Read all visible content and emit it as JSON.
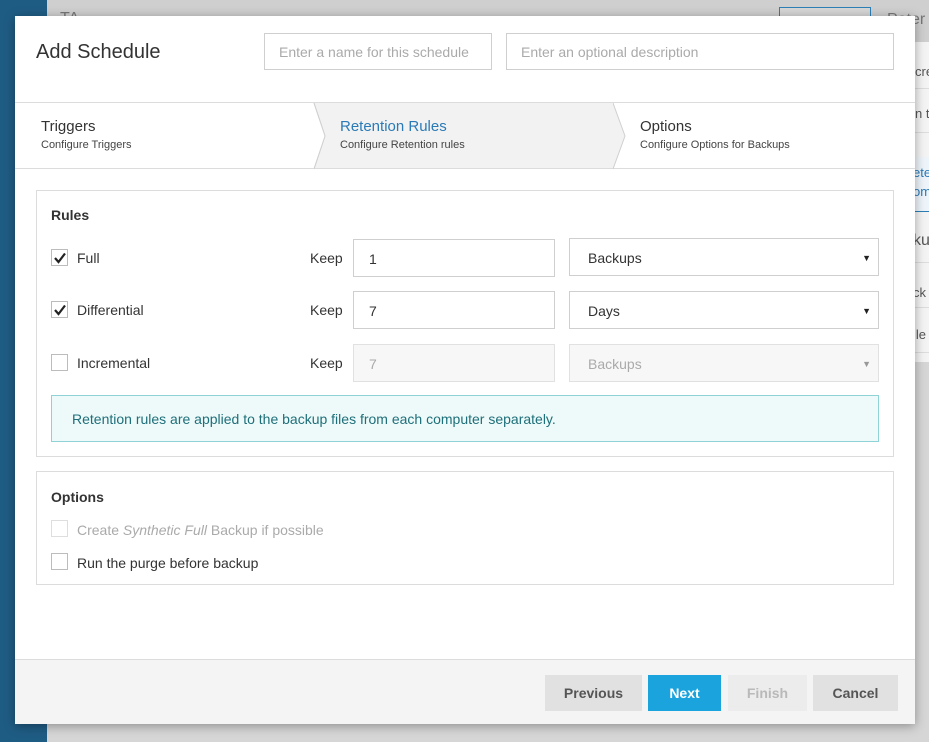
{
  "background": {
    "top_fragment": "TA",
    "right_fragments": [
      "Peter",
      "cre",
      "n t",
      "ete",
      "om",
      "ku",
      "ck",
      "ile"
    ]
  },
  "modal": {
    "title": "Add Schedule",
    "name_input": {
      "value": "",
      "placeholder": "Enter a name for this schedule"
    },
    "description_input": {
      "value": "",
      "placeholder": "Enter an optional description"
    }
  },
  "steps": [
    {
      "title": "Triggers",
      "subtitle": "Configure Triggers",
      "active": false
    },
    {
      "title": "Retention Rules",
      "subtitle": "Configure Retention rules",
      "active": true
    },
    {
      "title": "Options",
      "subtitle": "Configure Options for Backups",
      "active": false
    }
  ],
  "rules": {
    "title": "Rules",
    "keep_label": "Keep",
    "items": [
      {
        "label": "Full",
        "checked": true,
        "enabled": true,
        "keep_value": "1",
        "unit": "Backups"
      },
      {
        "label": "Differential",
        "checked": true,
        "enabled": true,
        "keep_value": "7",
        "unit": "Days"
      },
      {
        "label": "Incremental",
        "checked": false,
        "enabled": false,
        "keep_value": "7",
        "unit": "Backups"
      }
    ],
    "info": "Retention rules are applied to the backup files from each computer separately."
  },
  "options": {
    "title": "Options",
    "synthetic": {
      "prefix": "Create ",
      "emphasis": "Synthetic Full",
      "suffix": " Backup if possible",
      "checked": false,
      "enabled": false
    },
    "purge": {
      "label": "Run the purge before backup",
      "checked": false,
      "enabled": true
    }
  },
  "footer": {
    "previous": "Previous",
    "next": "Next",
    "finish": "Finish",
    "cancel": "Cancel"
  },
  "colors": {
    "accent": "#2a7ab7",
    "primary_button": "#1aa3dc",
    "info_background": "#eefaf9",
    "info_border": "#8fd3d6",
    "sidebar": "#1f5c84"
  }
}
